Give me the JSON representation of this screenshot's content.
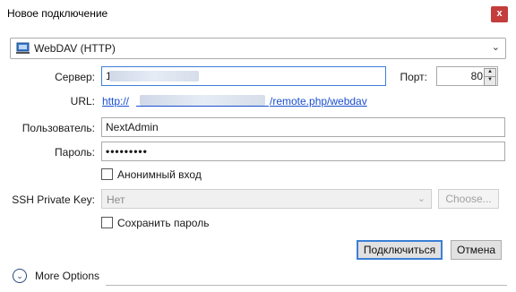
{
  "window": {
    "title": "Новое подключение",
    "close_glyph": "x"
  },
  "protocol": {
    "selected": "WebDAV (HTTP)",
    "icon": "network-drive-icon"
  },
  "server": {
    "label": "Сервер:",
    "value": "1"
  },
  "port": {
    "label": "Порт:",
    "value": "80"
  },
  "url": {
    "label": "URL:",
    "prefix": "http://",
    "suffix": "/remote.php/webdav"
  },
  "username": {
    "label": "Пользователь:",
    "value": "NextAdmin"
  },
  "password": {
    "label": "Пароль:",
    "value": "•••••••••"
  },
  "anonymous": {
    "label": "Анонимный вход",
    "checked": false
  },
  "ssh_key": {
    "label": "SSH Private Key:",
    "value": "Нет",
    "choose_label": "Choose..."
  },
  "save_password": {
    "label": "Сохранить пароль",
    "checked": false
  },
  "buttons": {
    "connect": "Подключиться",
    "cancel": "Отмена"
  },
  "more_options": {
    "label": "More Options"
  },
  "colors": {
    "accent": "#3c7fd6",
    "close": "#c43c3c",
    "link": "#1a4fd1"
  }
}
